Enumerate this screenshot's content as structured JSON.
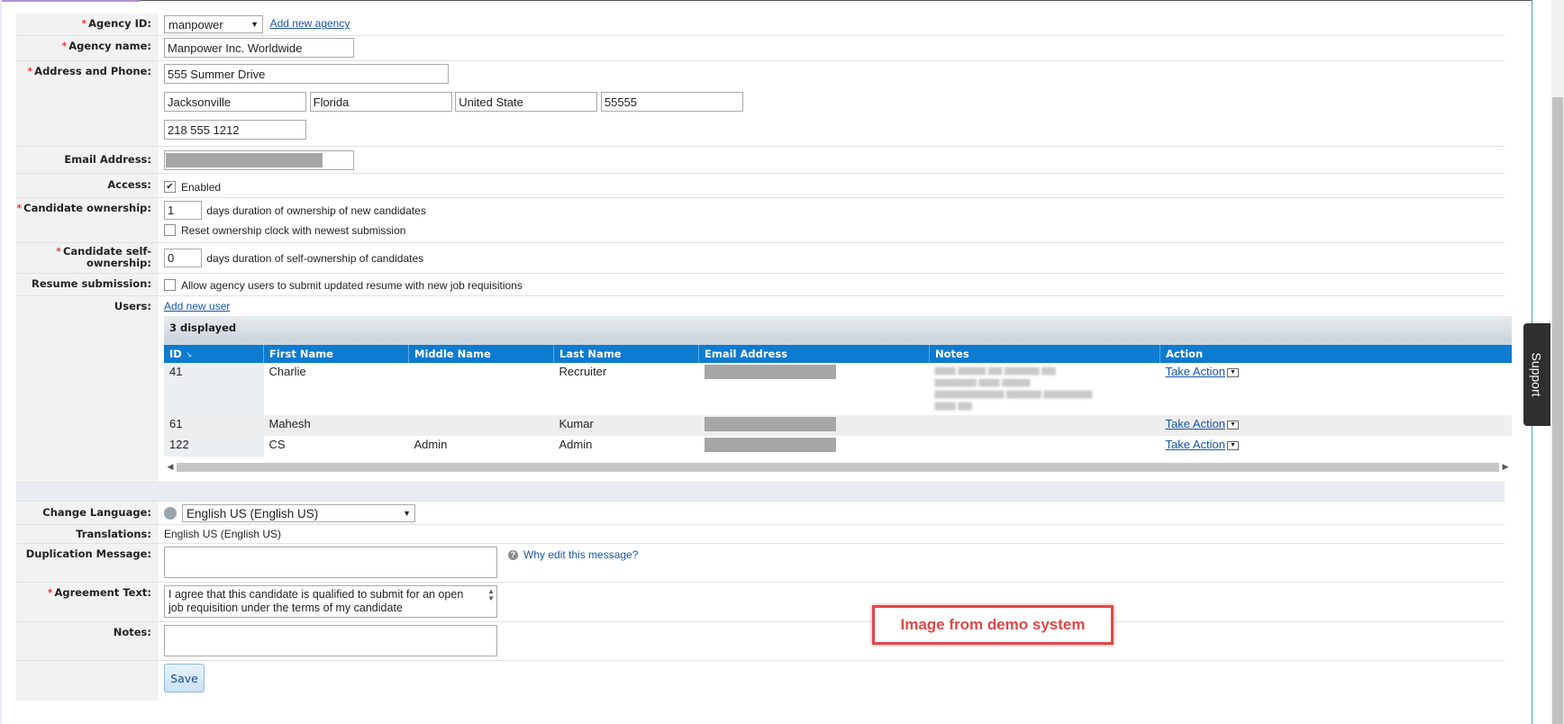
{
  "agency_id": {
    "label": "Agency ID:",
    "value": "manpower",
    "add_link": "Add new agency"
  },
  "agency_name": {
    "label": "Agency name:",
    "value": "Manpower Inc. Worldwide"
  },
  "address": {
    "label": "Address and Phone:",
    "street": "555 Summer Drive",
    "city": "Jacksonville",
    "state": "Florida",
    "country": "United State",
    "zip": "55555",
    "phone": "218 555 1212"
  },
  "email": {
    "label": "Email Address:"
  },
  "access": {
    "label": "Access:",
    "checkbox_label": "Enabled",
    "checked": true
  },
  "candidate_ownership": {
    "label": "Candidate ownership:",
    "value": "1",
    "suffix": "days duration of ownership of new candidates",
    "reset_label": "Reset ownership clock with newest submission"
  },
  "self_ownership": {
    "label_line1": "Candidate self-",
    "label_line2": "ownership:",
    "value": "0",
    "suffix": "days duration of self-ownership of candidates"
  },
  "resume": {
    "label": "Resume submission:",
    "checkbox_label": "Allow agency users to submit updated resume with new job requisitions"
  },
  "users": {
    "label": "Users:",
    "add_link": "Add new user",
    "count_text": "3 displayed",
    "columns": [
      "ID",
      "First Name",
      "Middle Name",
      "Last Name",
      "Email Address",
      "Notes",
      "Action"
    ],
    "rows": [
      {
        "id": "41",
        "first": "Charlie",
        "middle": "",
        "last": "Recruiter",
        "action": "Take Action"
      },
      {
        "id": "61",
        "first": "Mahesh",
        "middle": "",
        "last": "Kumar",
        "action": "Take Action"
      },
      {
        "id": "122",
        "first": "CS",
        "middle": "Admin",
        "last": "Admin",
        "action": "Take Action"
      }
    ]
  },
  "language": {
    "label": "Change Language:",
    "value": "English US (English US)"
  },
  "translations": {
    "label": "Translations:",
    "value": "English US (English US)"
  },
  "duplication": {
    "label": "Duplication Message:",
    "help_link": "Why edit this message?"
  },
  "agreement": {
    "label": "Agreement Text:",
    "text": "I agree that this candidate is qualified to submit for an open job requisition under the terms of my candidate"
  },
  "notes": {
    "label": "Notes:"
  },
  "save_label": "Save",
  "demo_note": "Image from demo system",
  "support_label": "Support"
}
